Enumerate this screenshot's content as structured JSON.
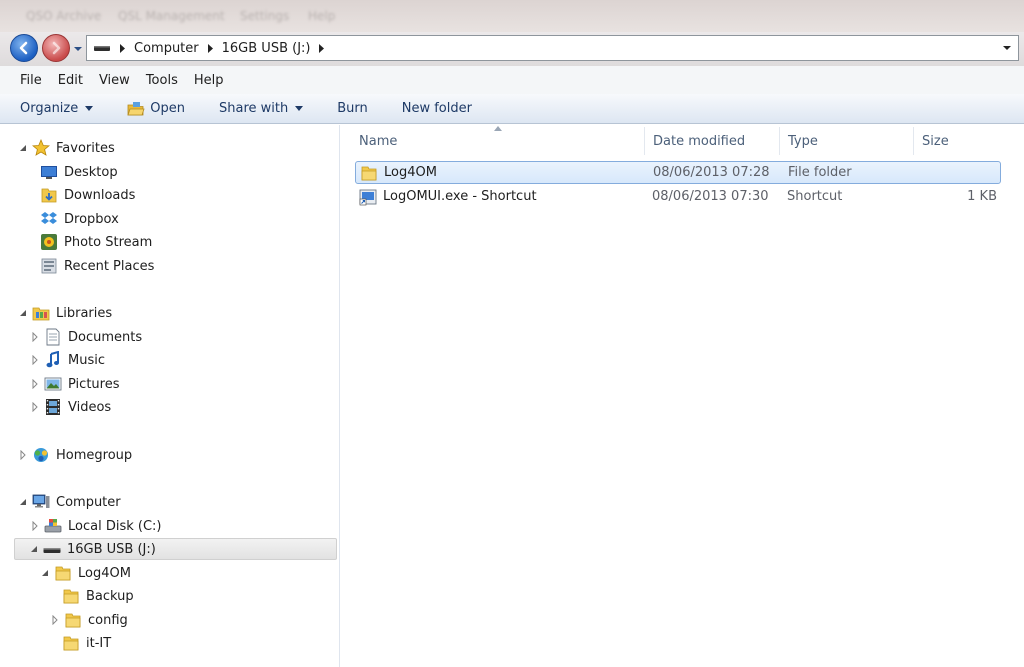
{
  "background_app_menu": [
    "QSO Archive",
    "QSL Management",
    "Settings",
    "Help"
  ],
  "address": {
    "crumbs": [
      "Computer",
      "16GB USB (J:)"
    ]
  },
  "menu": [
    "File",
    "Edit",
    "View",
    "Tools",
    "Help"
  ],
  "commands": {
    "organize": "Organize",
    "open": "Open",
    "share_with": "Share with",
    "burn": "Burn",
    "new_folder": "New folder"
  },
  "nav_tree": {
    "favorites": "Favorites",
    "desktop": "Desktop",
    "downloads": "Downloads",
    "dropbox": "Dropbox",
    "photo_stream": "Photo Stream",
    "recent_places": "Recent Places",
    "libraries": "Libraries",
    "documents": "Documents",
    "music": "Music",
    "pictures": "Pictures",
    "videos": "Videos",
    "homegroup": "Homegroup",
    "computer": "Computer",
    "local_disk": "Local Disk (C:)",
    "usb": "16GB USB (J:)",
    "log4om": "Log4OM",
    "backup": "Backup",
    "config": "config",
    "it_it": "it-IT"
  },
  "columns": {
    "name": "Name",
    "date_modified": "Date modified",
    "type": "Type",
    "size": "Size"
  },
  "files": [
    {
      "name": "Log4OM",
      "date": "08/06/2013 07:28",
      "type": "File folder",
      "size": ""
    },
    {
      "name": "LogOMUI.exe - Shortcut",
      "date": "08/06/2013 07:30",
      "type": "Shortcut",
      "size": "1 KB"
    }
  ],
  "colors": {
    "selection_fill": "#d7e8fb",
    "selection_border": "#84acdd",
    "command_text": "#1e3a66",
    "header_text": "#4c607a",
    "folder_yellow": "#f1c84b"
  }
}
